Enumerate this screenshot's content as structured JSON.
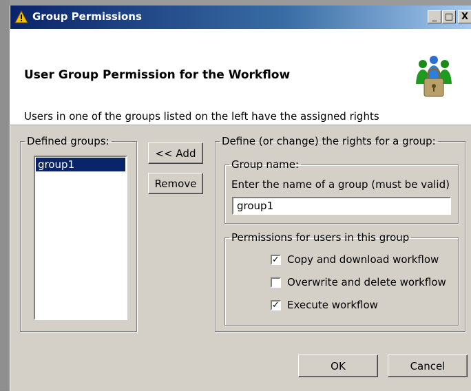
{
  "window": {
    "title": "Group Permissions",
    "minimize": "_",
    "maximize": "□",
    "close": "X"
  },
  "header": {
    "title": "User Group Permission for the Workflow",
    "description": "Users in one of the groups listed on the left have the assigned rights"
  },
  "defined_groups": {
    "legend": "Defined groups:",
    "items": [
      "group1"
    ],
    "selected": "group1"
  },
  "buttons": {
    "add": "<< Add",
    "remove": "Remove",
    "ok": "OK",
    "cancel": "Cancel"
  },
  "rights": {
    "legend": "Define (or change) the rights for a group:",
    "group_name": {
      "legend": "Group name:",
      "hint": "Enter the name of a group (must be valid)",
      "value": "group1"
    },
    "permissions": {
      "legend": "Permissions for users in this group",
      "options": [
        {
          "label": "Copy and download workflow",
          "checked": true
        },
        {
          "label": "Overwrite and delete workflow",
          "checked": false
        },
        {
          "label": "Execute workflow",
          "checked": true
        }
      ]
    }
  },
  "colors": {
    "titlebar_start": "#0a246a",
    "titlebar_end": "#a6caf0",
    "selection": "#0a246a",
    "dialog_bg": "#d4d0c8"
  }
}
